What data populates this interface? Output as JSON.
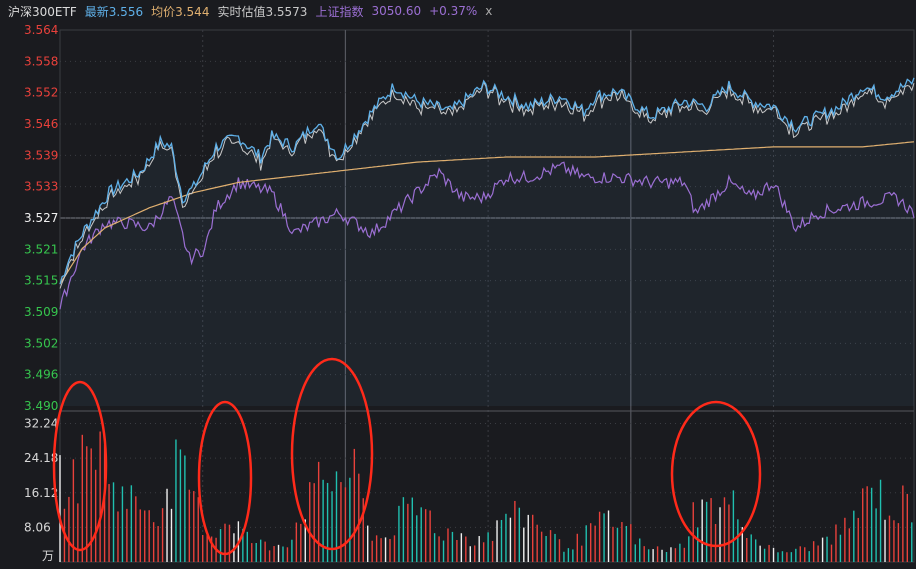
{
  "header": {
    "name": "沪深300ETF",
    "latest_label": "最新3.556",
    "avg_label": "均价3.544",
    "iopv_label": "实时估值3.5573",
    "index_name": "上证指数",
    "index_value": "3050.60",
    "index_change": "+0.37%",
    "close_symbol": "x"
  },
  "colors": {
    "background": "#1a1b1f",
    "price_line": "#5fb0e8",
    "iopv_line": "#c8c8c8",
    "avg_line": "#e0b070",
    "index_line": "#9b6fd3",
    "up": "#e8413b",
    "down": "#20c0b0",
    "flat": "#f0f0f0",
    "annotation": "#ff2a1a",
    "grid": "#3a3c42",
    "header_name": "#dcdcdc",
    "header_latest": "#5fb0e8",
    "header_avg": "#e0b070",
    "header_iopv": "#c8c8c8",
    "header_index": "#9b6fd3"
  },
  "chart_data": {
    "type": "line",
    "price_axis": {
      "ticks": [
        "3.564",
        "3.558",
        "3.552",
        "3.546",
        "3.539",
        "3.533",
        "3.527",
        "3.521",
        "3.515",
        "3.509",
        "3.502",
        "3.496",
        "3.490"
      ],
      "ylim": [
        3.49,
        3.564
      ],
      "reference": 3.527
    },
    "volume_axis": {
      "ticks": [
        "32.24",
        "24.18",
        "16.12",
        "8.06"
      ],
      "unit_label": "万",
      "ylim": [
        0,
        34
      ]
    },
    "series_keypoints": {
      "price": [
        [
          0,
          3.514
        ],
        [
          3,
          3.518
        ],
        [
          10,
          3.524
        ],
        [
          22,
          3.532
        ],
        [
          36,
          3.536
        ],
        [
          45,
          3.542
        ],
        [
          50,
          3.541
        ],
        [
          55,
          3.531
        ],
        [
          60,
          3.533
        ],
        [
          70,
          3.541
        ],
        [
          80,
          3.543
        ],
        [
          90,
          3.539
        ],
        [
          95,
          3.543
        ],
        [
          105,
          3.541
        ],
        [
          115,
          3.546
        ],
        [
          125,
          3.539
        ],
        [
          140,
          3.548
        ],
        [
          150,
          3.553
        ],
        [
          160,
          3.55
        ],
        [
          175,
          3.548
        ],
        [
          190,
          3.553
        ],
        [
          200,
          3.551
        ],
        [
          210,
          3.549
        ],
        [
          225,
          3.551
        ],
        [
          235,
          3.548
        ],
        [
          240,
          3.551
        ],
        [
          250,
          3.552
        ],
        [
          265,
          3.547
        ],
        [
          280,
          3.55
        ],
        [
          290,
          3.549
        ],
        [
          300,
          3.553
        ],
        [
          310,
          3.55
        ],
        [
          320,
          3.549
        ],
        [
          330,
          3.545
        ],
        [
          350,
          3.549
        ],
        [
          360,
          3.553
        ],
        [
          370,
          3.551
        ],
        [
          383,
          3.554
        ]
      ],
      "iopv": [
        [
          0,
          3.512
        ],
        [
          3,
          3.517
        ],
        [
          10,
          3.523
        ],
        [
          22,
          3.531
        ],
        [
          36,
          3.534
        ],
        [
          45,
          3.539
        ],
        [
          50,
          3.539
        ],
        [
          55,
          3.532
        ],
        [
          60,
          3.532
        ],
        [
          70,
          3.539
        ],
        [
          80,
          3.542
        ],
        [
          90,
          3.538
        ],
        [
          95,
          3.541
        ],
        [
          105,
          3.54
        ],
        [
          115,
          3.545
        ],
        [
          125,
          3.538
        ],
        [
          140,
          3.547
        ],
        [
          150,
          3.551
        ],
        [
          160,
          3.549
        ],
        [
          175,
          3.547
        ],
        [
          190,
          3.552
        ],
        [
          200,
          3.55
        ],
        [
          210,
          3.548
        ],
        [
          225,
          3.55
        ],
        [
          235,
          3.547
        ],
        [
          240,
          3.55
        ],
        [
          250,
          3.55
        ],
        [
          265,
          3.545
        ],
        [
          280,
          3.549
        ],
        [
          290,
          3.548
        ],
        [
          300,
          3.552
        ],
        [
          310,
          3.549
        ],
        [
          320,
          3.548
        ],
        [
          330,
          3.544
        ],
        [
          350,
          3.548
        ],
        [
          360,
          3.552
        ],
        [
          370,
          3.55
        ],
        [
          383,
          3.553
        ]
      ],
      "avg": [
        [
          0,
          3.514
        ],
        [
          10,
          3.521
        ],
        [
          20,
          3.525
        ],
        [
          40,
          3.529
        ],
        [
          60,
          3.532
        ],
        [
          80,
          3.534
        ],
        [
          100,
          3.535
        ],
        [
          120,
          3.536
        ],
        [
          140,
          3.537
        ],
        [
          160,
          3.538
        ],
        [
          200,
          3.539
        ],
        [
          240,
          3.539
        ],
        [
          280,
          3.54
        ],
        [
          320,
          3.541
        ],
        [
          360,
          3.541
        ],
        [
          383,
          3.542
        ]
      ],
      "index": [
        [
          0,
          3.509
        ],
        [
          3,
          3.513
        ],
        [
          10,
          3.521
        ],
        [
          20,
          3.526
        ],
        [
          30,
          3.526
        ],
        [
          40,
          3.525
        ],
        [
          50,
          3.531
        ],
        [
          58,
          3.519
        ],
        [
          65,
          3.521
        ],
        [
          70,
          3.529
        ],
        [
          80,
          3.534
        ],
        [
          95,
          3.532
        ],
        [
          105,
          3.524
        ],
        [
          115,
          3.526
        ],
        [
          125,
          3.528
        ],
        [
          140,
          3.524
        ],
        [
          150,
          3.528
        ],
        [
          160,
          3.532
        ],
        [
          170,
          3.536
        ],
        [
          180,
          3.531
        ],
        [
          190,
          3.531
        ],
        [
          200,
          3.535
        ],
        [
          210,
          3.535
        ],
        [
          225,
          3.537
        ],
        [
          235,
          3.535
        ],
        [
          250,
          3.535
        ],
        [
          265,
          3.534
        ],
        [
          280,
          3.534
        ],
        [
          285,
          3.528
        ],
        [
          300,
          3.534
        ],
        [
          310,
          3.531
        ],
        [
          320,
          3.534
        ],
        [
          330,
          3.525
        ],
        [
          340,
          3.528
        ],
        [
          360,
          3.53
        ],
        [
          375,
          3.531
        ],
        [
          383,
          3.528
        ]
      ]
    },
    "volume_keypoints": [
      [
        0,
        22
      ],
      [
        8,
        24
      ],
      [
        12,
        30
      ],
      [
        17,
        33
      ],
      [
        22,
        24
      ],
      [
        28,
        18
      ],
      [
        36,
        16
      ],
      [
        40,
        15
      ],
      [
        44,
        15
      ],
      [
        48,
        16
      ],
      [
        52,
        25
      ],
      [
        58,
        21
      ],
      [
        62,
        14
      ],
      [
        65,
        9
      ],
      [
        70,
        8
      ],
      [
        75,
        12
      ],
      [
        80,
        10
      ],
      [
        85,
        6
      ],
      [
        90,
        5
      ],
      [
        95,
        4
      ],
      [
        100,
        6
      ],
      [
        103,
        5
      ],
      [
        108,
        14
      ],
      [
        110,
        16
      ],
      [
        114,
        18
      ],
      [
        118,
        23
      ],
      [
        122,
        23
      ],
      [
        126,
        24
      ],
      [
        130,
        22
      ],
      [
        134,
        24
      ],
      [
        137,
        10
      ],
      [
        140,
        8
      ],
      [
        145,
        6
      ],
      [
        150,
        10
      ],
      [
        155,
        14
      ],
      [
        160,
        14
      ],
      [
        165,
        14
      ],
      [
        170,
        8
      ],
      [
        178,
        8
      ],
      [
        185,
        6
      ],
      [
        195,
        8
      ],
      [
        200,
        14
      ],
      [
        205,
        12
      ],
      [
        210,
        13
      ],
      [
        215,
        10
      ],
      [
        220,
        8
      ],
      [
        225,
        4
      ],
      [
        230,
        5
      ],
      [
        235,
        7
      ],
      [
        240,
        10
      ],
      [
        245,
        11
      ],
      [
        250,
        10
      ],
      [
        255,
        9
      ],
      [
        260,
        5
      ],
      [
        265,
        3
      ],
      [
        270,
        4
      ],
      [
        275,
        3
      ],
      [
        280,
        5
      ],
      [
        283,
        13
      ],
      [
        286,
        14
      ],
      [
        290,
        15
      ],
      [
        295,
        14
      ],
      [
        300,
        16
      ],
      [
        305,
        14
      ],
      [
        310,
        7
      ],
      [
        315,
        5
      ],
      [
        320,
        3
      ],
      [
        325,
        3
      ],
      [
        330,
        3
      ],
      [
        335,
        4
      ],
      [
        340,
        5
      ],
      [
        345,
        7
      ],
      [
        350,
        8
      ],
      [
        354,
        11
      ],
      [
        358,
        14
      ],
      [
        362,
        18
      ],
      [
        366,
        20
      ],
      [
        370,
        16
      ],
      [
        374,
        12
      ],
      [
        378,
        16
      ],
      [
        383,
        15
      ]
    ],
    "annotations": [
      "circle-left",
      "circle-mid1",
      "circle-mid2",
      "circle-right"
    ]
  }
}
